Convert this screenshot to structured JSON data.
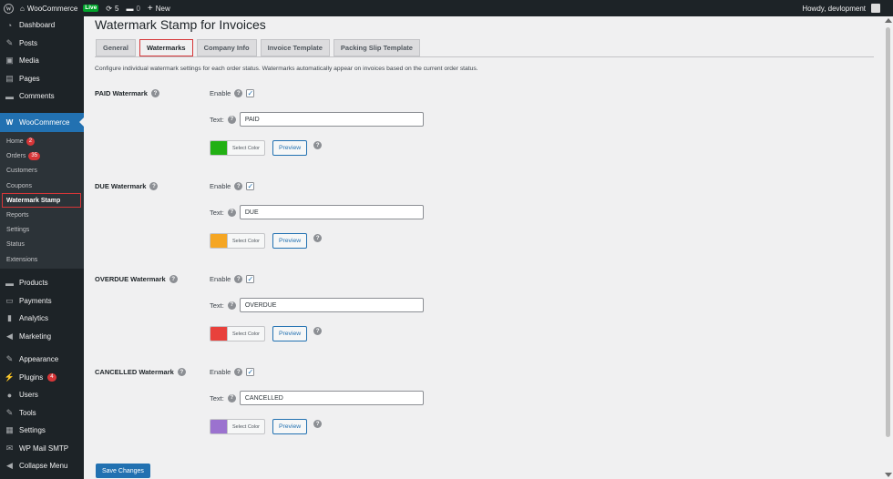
{
  "adminbar": {
    "site_name": "WooCommerce",
    "live_badge": "Live",
    "updates_count": "5",
    "comments_count": "0",
    "new_label": "New",
    "howdy": "Howdy, devlopment"
  },
  "sidebar": {
    "top_items": [
      {
        "label": "Dashboard",
        "icon": "dashboard-icon"
      },
      {
        "label": "Posts",
        "icon": "pin-icon"
      },
      {
        "label": "Media",
        "icon": "media-icon"
      },
      {
        "label": "Pages",
        "icon": "pages-icon"
      },
      {
        "label": "Comments",
        "icon": "comment-icon"
      }
    ],
    "woocommerce_label": "WooCommerce",
    "woo_icon_text": "W",
    "submenu": [
      {
        "label": "Home",
        "badge": "2"
      },
      {
        "label": "Orders",
        "badge": "35"
      },
      {
        "label": "Customers"
      },
      {
        "label": "Coupons"
      },
      {
        "label": "Watermark Stamp"
      },
      {
        "label": "Reports"
      },
      {
        "label": "Settings"
      },
      {
        "label": "Status"
      },
      {
        "label": "Extensions"
      }
    ],
    "bottom_items": [
      {
        "label": "Products",
        "icon": "products-icon"
      },
      {
        "label": "Payments",
        "icon": "payments-icon"
      },
      {
        "label": "Analytics",
        "icon": "analytics-icon"
      },
      {
        "label": "Marketing",
        "icon": "megaphone-icon"
      },
      {
        "label": "Appearance",
        "icon": "brush-icon"
      },
      {
        "label": "Plugins",
        "icon": "plugin-icon",
        "badge": "4"
      },
      {
        "label": "Users",
        "icon": "user-icon"
      },
      {
        "label": "Tools",
        "icon": "wrench-icon"
      },
      {
        "label": "Settings",
        "icon": "settings-icon"
      },
      {
        "label": "WP Mail SMTP",
        "icon": "mail-icon"
      },
      {
        "label": "Collapse Menu",
        "icon": "collapse-icon"
      }
    ]
  },
  "main": {
    "title": "Watermark Stamp for Invoices",
    "tabs": [
      "General",
      "Watermarks",
      "Company Info",
      "Invoice Template",
      "Packing Slip Template"
    ],
    "description": "Configure individual watermark settings for each order status. Watermarks automatically appear on invoices based on the current order status.",
    "enable_label": "Enable",
    "text_label": "Text:",
    "select_color_label": "Select Color",
    "preview_label": "Preview",
    "help_glyph": "?",
    "check_glyph": "✓",
    "watermarks": [
      {
        "label": "PAID Watermark",
        "text": "PAID",
        "color": "#22b014",
        "enabled": true
      },
      {
        "label": "DUE Watermark",
        "text": "DUE",
        "color": "#f5a623",
        "enabled": true
      },
      {
        "label": "OVERDUE Watermark",
        "text": "OVERDUE",
        "color": "#e8413c",
        "enabled": true
      },
      {
        "label": "CANCELLED Watermark",
        "text": "CANCELLED",
        "color": "#9b72cf",
        "enabled": true
      }
    ],
    "save_label": "Save Changes"
  }
}
